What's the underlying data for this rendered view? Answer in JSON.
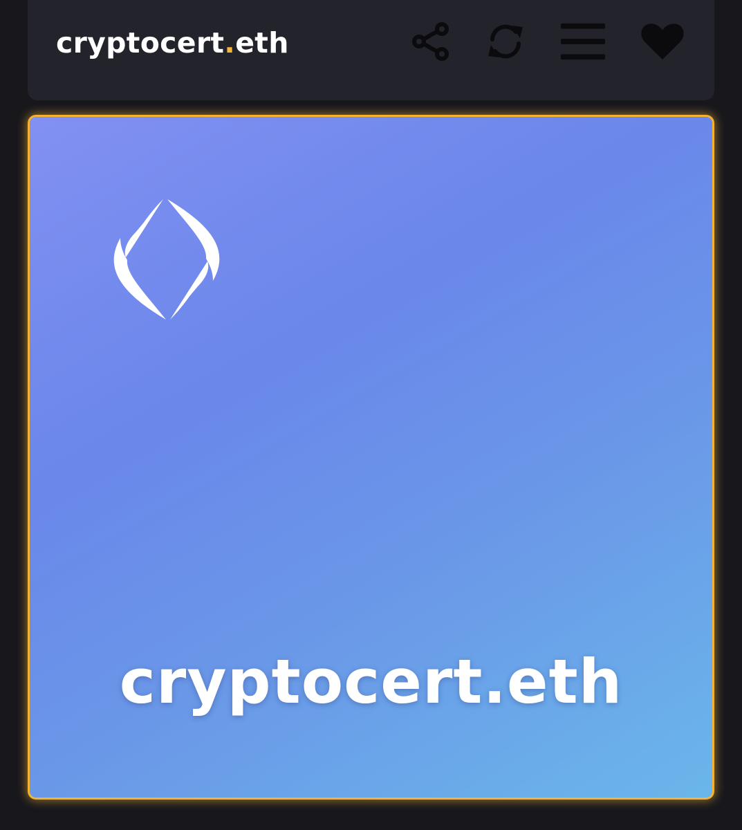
{
  "header": {
    "title_name": "cryptocert",
    "title_dot": ".",
    "title_tld": "eth",
    "accent_color": "#f5b53a",
    "actions": [
      {
        "icon": "share-icon"
      },
      {
        "icon": "refresh-icon"
      },
      {
        "icon": "menu-icon"
      },
      {
        "icon": "heart-icon"
      }
    ]
  },
  "nft": {
    "logo": "ens-logo",
    "name": "cryptocert.eth",
    "border_color": "#f3b234"
  }
}
